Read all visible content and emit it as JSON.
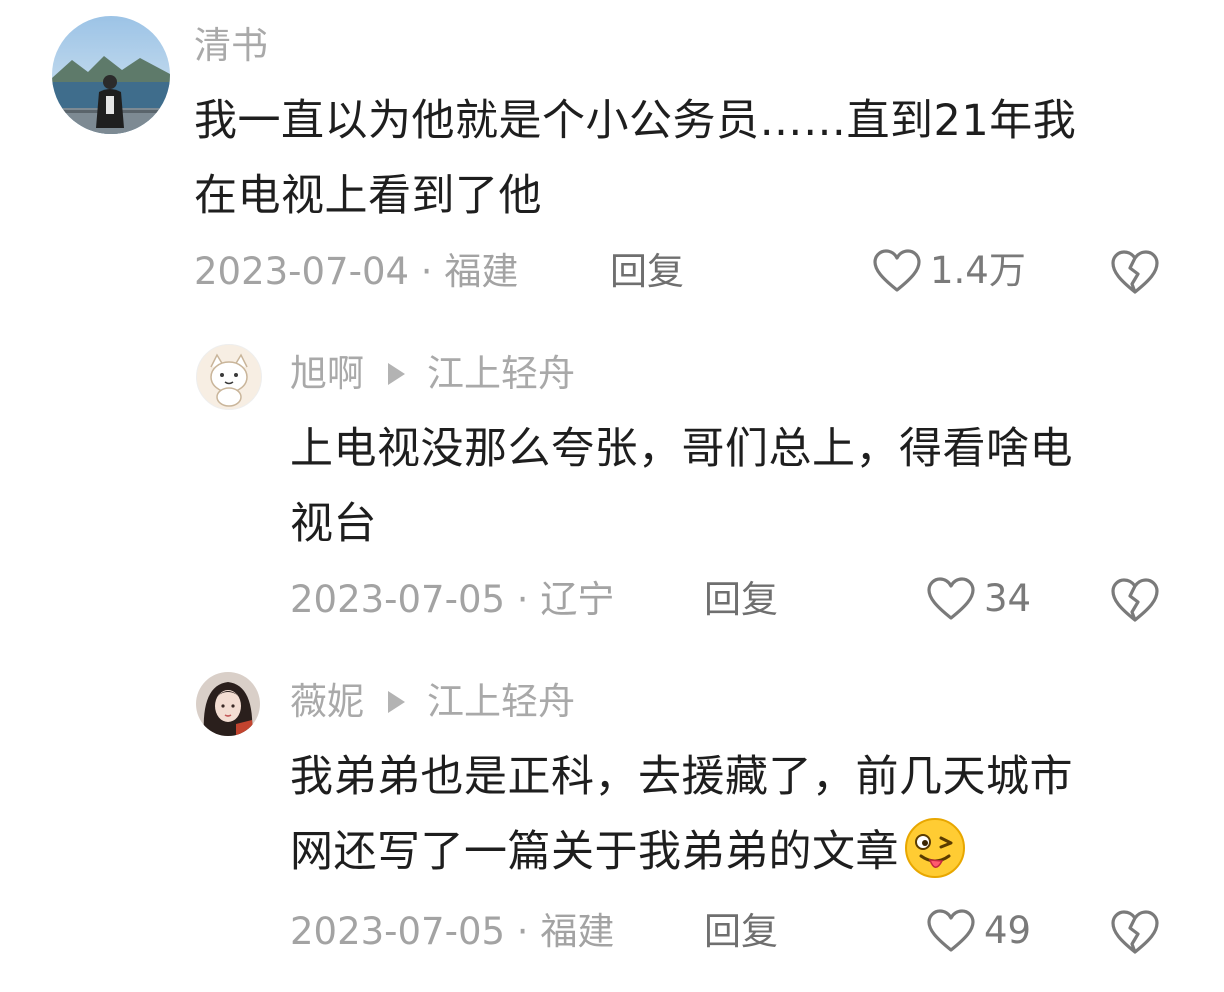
{
  "comments": [
    {
      "username": "清书",
      "text_lines": [
        "我一直以为他就是个小公务员……直到21年我",
        "在电视上看到了他"
      ],
      "date": "2023-07-04",
      "location": "福建",
      "reply_label": "回复",
      "likes": "1.4万"
    }
  ],
  "replies": [
    {
      "username": "旭啊",
      "reply_to": "江上轻舟",
      "text_lines": [
        "上电视没那么夸张，哥们总上，得看啥电",
        "视台"
      ],
      "date": "2023-07-05",
      "location": "辽宁",
      "reply_label": "回复",
      "likes": "34"
    },
    {
      "username": "薇妮",
      "reply_to": "江上轻舟",
      "text_lines": [
        "我弟弟也是正科，去援藏了，前几天城市",
        "网还写了一篇关于我弟弟的文章"
      ],
      "emoji": "winking-tongue-emoji",
      "date": "2023-07-05",
      "location": "福建",
      "reply_label": "回复",
      "likes": "49"
    }
  ],
  "separator": " · ",
  "colors": {
    "username": "#a9a9a9",
    "body": "#1e1e1e",
    "meta": "#a3a3a3",
    "reply": "#6f6f6f",
    "icon": "#7a7a7a"
  }
}
